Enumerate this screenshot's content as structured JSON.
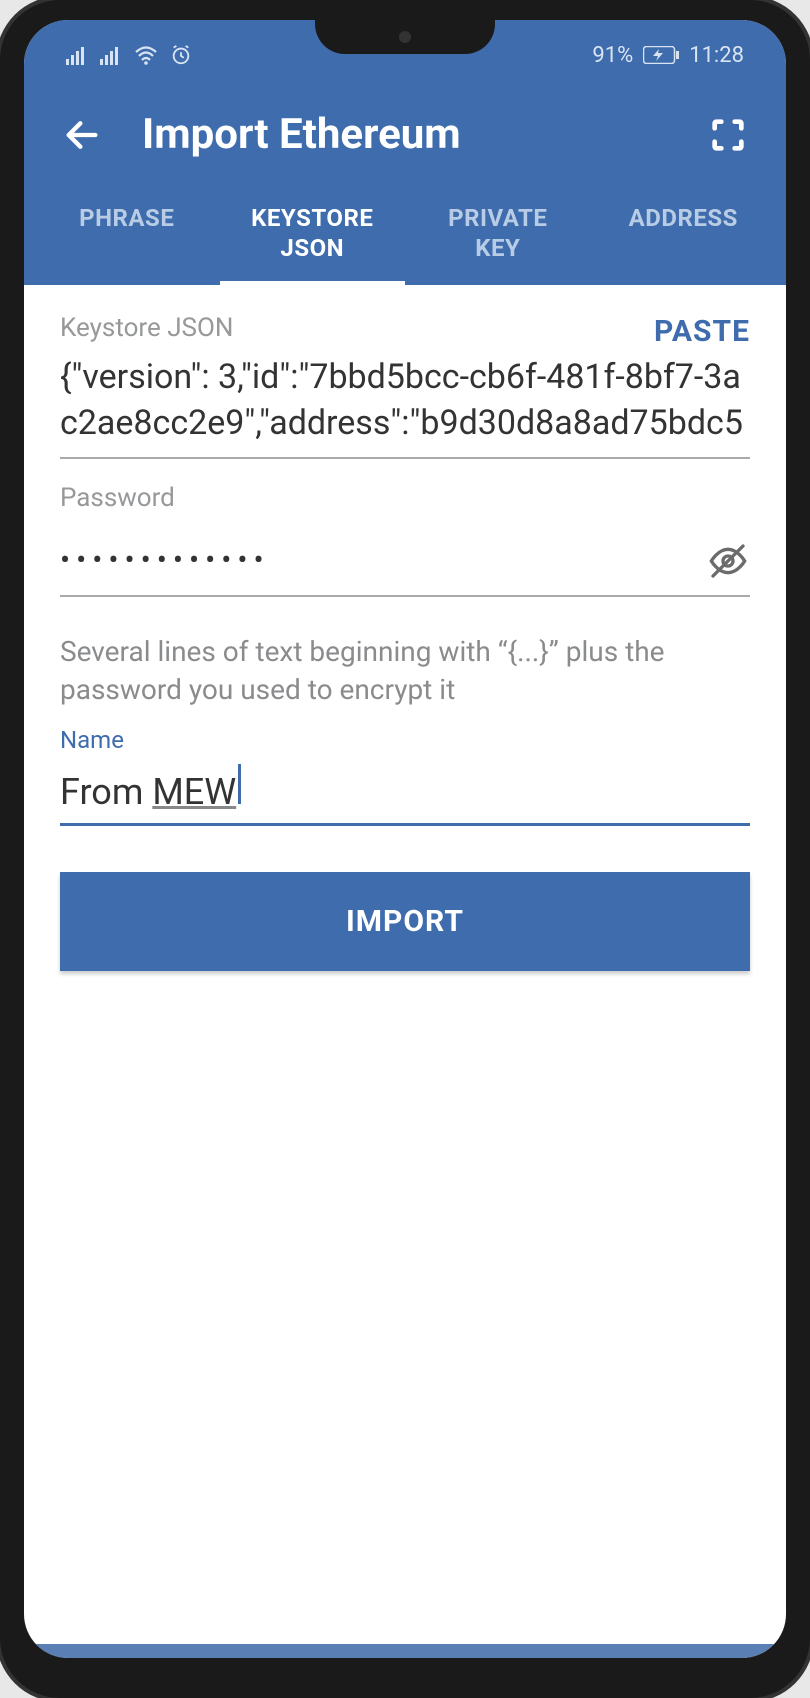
{
  "status": {
    "battery_pct": "91%",
    "time": "11:28"
  },
  "header": {
    "title": "Import Ethereum"
  },
  "tabs": [
    {
      "label": "PHRASE",
      "active": false
    },
    {
      "label": "KEYSTORE\nJSON",
      "active": true
    },
    {
      "label": "PRIVATE\nKEY",
      "active": false
    },
    {
      "label": "ADDRESS",
      "active": false
    }
  ],
  "keystore": {
    "label": "Keystore JSON",
    "paste_label": "PASTE",
    "value": "{\"version\": 3,\"id\":\"7bbd5bcc-cb6f-481f-8bf7-3ac2ae8cc2e9\",\"address\":\"b9d30d8a8ad75bdc5"
  },
  "password": {
    "label": "Password",
    "mask": "•••••••••••••"
  },
  "helper": "Several lines of text beginning with “{...}” plus the password you used to encrypt it",
  "name": {
    "label": "Name",
    "value_prefix": "From ",
    "value_underlined": "MEW"
  },
  "import_label": "IMPORT",
  "colors": {
    "primary": "#3f6cad"
  }
}
